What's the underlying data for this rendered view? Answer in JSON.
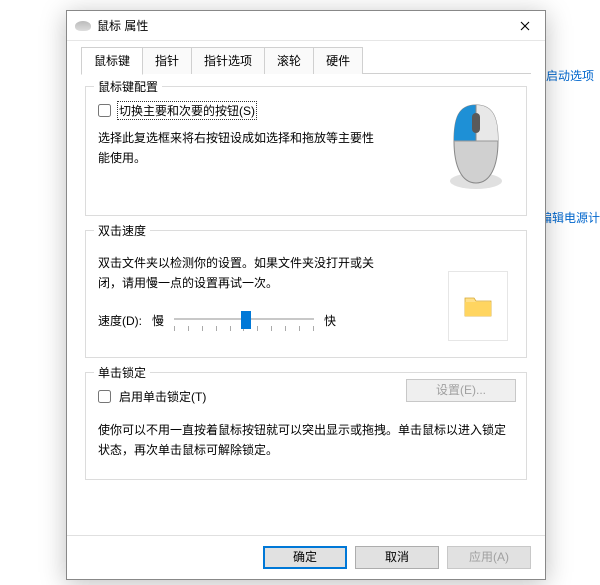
{
  "window": {
    "title": "鼠标 属性"
  },
  "bg_links": {
    "startup": "启动选项",
    "edit_power": "编辑电源计"
  },
  "tabs": [
    {
      "label": "鼠标键",
      "active": true
    },
    {
      "label": "指针",
      "active": false
    },
    {
      "label": "指针选项",
      "active": false
    },
    {
      "label": "滚轮",
      "active": false
    },
    {
      "label": "硬件",
      "active": false
    }
  ],
  "groups": {
    "buttons": {
      "title": "鼠标键配置",
      "swap_label": "切换主要和次要的按钮(S)",
      "swap_checked": false,
      "desc": "选择此复选框来将右按钮设成如选择和拖放等主要性能使用。"
    },
    "doubleclick": {
      "title": "双击速度",
      "desc": "双击文件夹以检测你的设置。如果文件夹没打开或关闭，请用慢一点的设置再试一次。",
      "speed_label": "速度(D):",
      "slow": "慢",
      "fast": "快",
      "value": 6,
      "min": 0,
      "max": 10
    },
    "clicklock": {
      "title": "单击锁定",
      "enable_label": "启用单击锁定(T)",
      "enable_checked": false,
      "settings_btn": "设置(E)...",
      "desc": "使你可以不用一直按着鼠标按钮就可以突出显示或拖拽。单击鼠标以进入锁定状态，再次单击鼠标可解除锁定。"
    }
  },
  "buttons": {
    "ok": "确定",
    "cancel": "取消",
    "apply": "应用(A)"
  }
}
